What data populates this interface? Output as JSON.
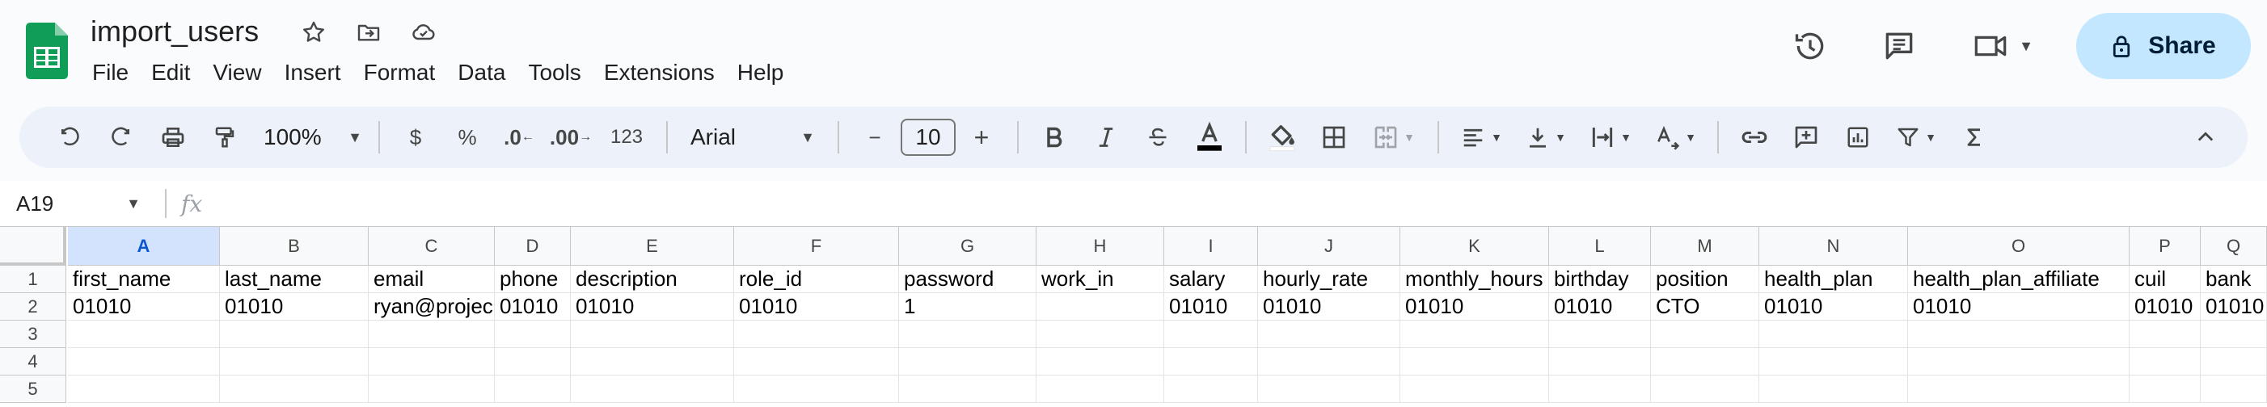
{
  "doc": {
    "title": "import_users"
  },
  "menu": [
    "File",
    "Edit",
    "View",
    "Insert",
    "Format",
    "Data",
    "Tools",
    "Extensions",
    "Help"
  ],
  "share": {
    "label": "Share"
  },
  "toolbar": {
    "zoom": "100%",
    "currency": "$",
    "percent": "%",
    "decimal_decrease": ".0",
    "decimal_increase": ".00",
    "number_format": "123",
    "font": "Arial",
    "font_size": "10",
    "minus": "−",
    "plus": "+"
  },
  "formula_bar": {
    "name_box": "A19",
    "fx": "fx",
    "value": ""
  },
  "grid": {
    "selected_column": "A",
    "columns": [
      "A",
      "B",
      "C",
      "D",
      "E",
      "F",
      "G",
      "H",
      "I",
      "J",
      "K",
      "L",
      "M",
      "N",
      "O",
      "P",
      "Q"
    ],
    "rows": [
      "1",
      "2",
      "3",
      "4",
      "5"
    ],
    "cells": [
      [
        "first_name",
        "last_name",
        "email",
        "phone",
        "description",
        "role_id",
        "password",
        "work_in",
        "salary",
        "hourly_rate",
        "monthly_hours",
        "birthday",
        "position",
        "health_plan",
        "health_plan_affiliate",
        "cuil",
        "bank"
      ],
      [
        "01010",
        "01010",
        "ryan@projec",
        "01010",
        "01010",
        "01010",
        "1",
        "",
        "01010",
        "01010",
        "01010",
        "01010",
        "CTO",
        "01010",
        "01010",
        "01010",
        "01010"
      ],
      [
        "",
        "",
        "",
        "",
        "",
        "",
        "",
        "",
        "",
        "",
        "",
        "",
        "",
        "",
        "",
        "",
        ""
      ],
      [
        "",
        "",
        "",
        "",
        "",
        "",
        "",
        "",
        "",
        "",
        "",
        "",
        "",
        "",
        "",
        "",
        ""
      ],
      [
        "",
        "",
        "",
        "",
        "",
        "",
        "",
        "",
        "",
        "",
        "",
        "",
        "",
        "",
        "",
        "",
        ""
      ]
    ]
  },
  "colors": {
    "accent": "#0b57d0",
    "share_bg": "#c2e7ff",
    "toolbar_bg": "#edf2fa",
    "sheets_green": "#0f9d58"
  }
}
